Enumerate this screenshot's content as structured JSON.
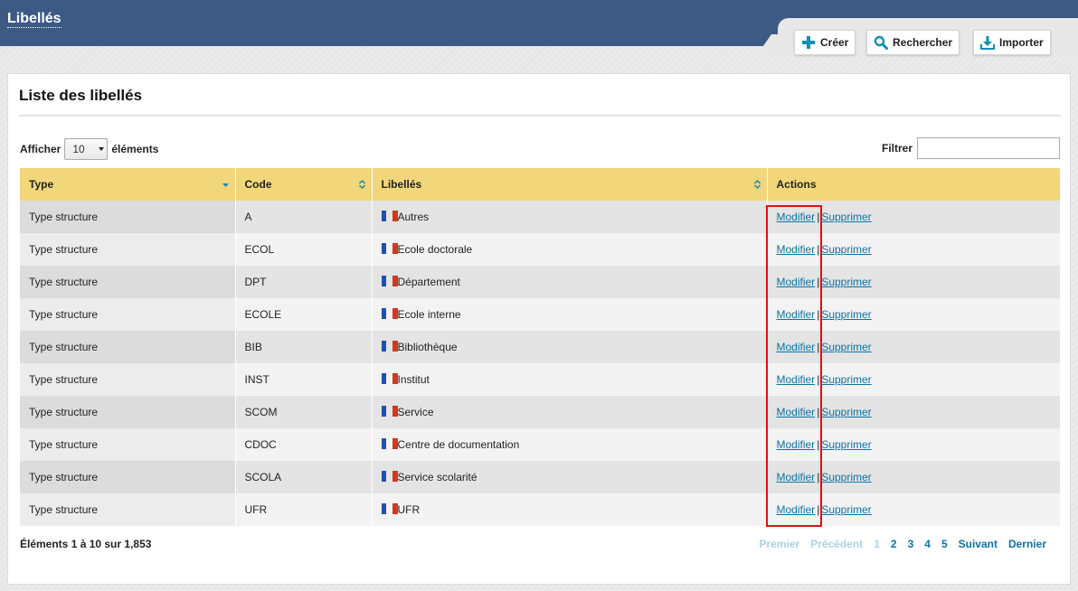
{
  "header": {
    "title": "Libellés"
  },
  "toolbar": {
    "create_label": "Créer",
    "search_label": "Rechercher",
    "import_label": "Importer",
    "accent": "#0e8fb5"
  },
  "panel": {
    "title": "Liste des libellés",
    "show_label": "Afficher",
    "page_size": "10",
    "elements_label": "éléments",
    "filter_label": "Filtrer",
    "filter_value": ""
  },
  "table": {
    "columns": [
      "Type",
      "Code",
      "Libellés",
      "Actions"
    ],
    "rows": [
      {
        "type": "Type structure",
        "code": "A",
        "label": "Autres"
      },
      {
        "type": "Type structure",
        "code": "ECOL",
        "label": "Ecole doctorale"
      },
      {
        "type": "Type structure",
        "code": "DPT",
        "label": "Département"
      },
      {
        "type": "Type structure",
        "code": "ECOLE",
        "label": "Ecole interne"
      },
      {
        "type": "Type structure",
        "code": "BIB",
        "label": "Bibliothèque"
      },
      {
        "type": "Type structure",
        "code": "INST",
        "label": "Institut"
      },
      {
        "type": "Type structure",
        "code": "SCOM",
        "label": "Service"
      },
      {
        "type": "Type structure",
        "code": "CDOC",
        "label": "Centre de documentation"
      },
      {
        "type": "Type structure",
        "code": "SCOLA",
        "label": "Service scolarité"
      },
      {
        "type": "Type structure",
        "code": "UFR",
        "label": "UFR"
      }
    ],
    "action_edit": "Modifier",
    "action_delete": "Supprimer",
    "action_sep": "|",
    "flag_icon": "french-flag-icon"
  },
  "footer": {
    "info": "Éléments 1 à 10 sur 1,853",
    "pager": {
      "first": "Premier",
      "previous": "Précédent",
      "pages": [
        "1",
        "2",
        "3",
        "4",
        "5"
      ],
      "current": "1",
      "next": "Suivant",
      "last": "Dernier"
    }
  }
}
